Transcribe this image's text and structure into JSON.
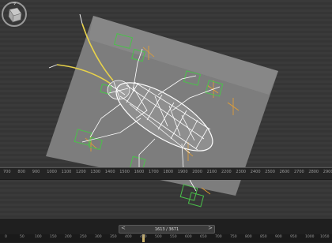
{
  "ruler": {
    "labels": [
      "700",
      "800",
      "900",
      "1000",
      "1100",
      "1200",
      "1300",
      "1400",
      "1500",
      "1600",
      "1700",
      "1800",
      "1900",
      "2000",
      "2100",
      "2200",
      "2300",
      "2400",
      "2500",
      "2600",
      "2700",
      "2800",
      "2900"
    ]
  },
  "time_slider": {
    "readout": "1613 / 3671",
    "prev_label": "<",
    "next_label": ">"
  },
  "timeline": {
    "labels": [
      "0",
      "50",
      "100",
      "150",
      "200",
      "250",
      "300",
      "350",
      "400",
      "450",
      "500",
      "550",
      "600",
      "650",
      "700",
      "750",
      "800",
      "850",
      "900",
      "950",
      "1000",
      "1050"
    ],
    "current_frame": 1613,
    "total_frames": 3671
  },
  "colors": {
    "viewport_bg": "#3a3a3a",
    "plane": "#8a8a8a",
    "wireframe": "#ffffff",
    "antenna": "#e8d24a",
    "controls": "#4ac24a",
    "gizmo": "#e8a030",
    "marker": "#c8b06a"
  },
  "icons": {
    "viewcube": "viewcube-icon"
  }
}
